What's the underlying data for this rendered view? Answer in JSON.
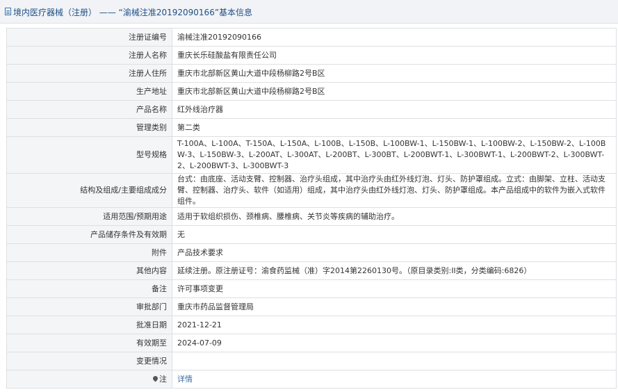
{
  "header": {
    "title": "境内医疗器械（注册） —— “渝械注准20192090166”基本信息",
    "icon": "document-icon"
  },
  "rows": [
    {
      "label": "注册证编号",
      "value": "渝械注准20192090166"
    },
    {
      "label": "注册人名称",
      "value": "重庆长乐硅酸盐有限责任公司"
    },
    {
      "label": "注册人住所",
      "value": "重庆市北部新区黄山大道中段杨柳路2号B区"
    },
    {
      "label": "生产地址",
      "value": "重庆市北部新区黄山大道中段杨柳路2号B区"
    },
    {
      "label": "产品名称",
      "value": "红外线治疗器"
    },
    {
      "label": "管理类别",
      "value": "第二类"
    },
    {
      "label": "型号规格",
      "value": "T-100A、L-100A、T-150A、L-150A、L-100B、L-150B、L-100BW-1、L-150BW-1、L-100BW-2、L-150BW-2、L-100BW-3、L-150BW-3、L-200AT、L-300AT、L-200BT、L-300BT、L-200BWT-1、L-300BWT-1、L-200BWT-2、L-300BWT-2、L-200BWT-3、L-300BWT-3"
    },
    {
      "label": "结构及组成/主要组成成分",
      "value": "台式：由底座、活动支臂、控制器、治疗头组成，其中治疗头由红外线灯泡、灯头、防护罩组成。立式：由脚架、立柱、活动支臂、控制器、治疗头、软件（如适用）组成，其中治疗头由红外线灯泡、灯头、防护罩组成。本产品组成中的软件为嵌入式软件组件。"
    },
    {
      "label": "适用范围/预期用途",
      "value": "适用于软组织损伤、颈椎病、腰椎病、关节炎等疾病的辅助治疗。"
    },
    {
      "label": "产品储存条件及有效期",
      "value": "无"
    },
    {
      "label": "附件",
      "value": "产品技术要求"
    },
    {
      "label": "其他内容",
      "value": "延续注册。原注册证号：渝食药监械（准）字2014第2260130号。（原目录类别:II类，分类编码:6826）"
    },
    {
      "label": "备注",
      "value": "许可事项变更"
    },
    {
      "label": "审批部门",
      "value": "重庆市药品监督管理局"
    },
    {
      "label": "批准日期",
      "value": "2021-12-21"
    },
    {
      "label": "有效期至",
      "value": "2024-07-09"
    },
    {
      "label": "变更情况",
      "value": ""
    }
  ],
  "note": {
    "label": "注",
    "icon": "pin-icon",
    "link_text": "详情",
    "link_color": "#3a6ea5"
  }
}
